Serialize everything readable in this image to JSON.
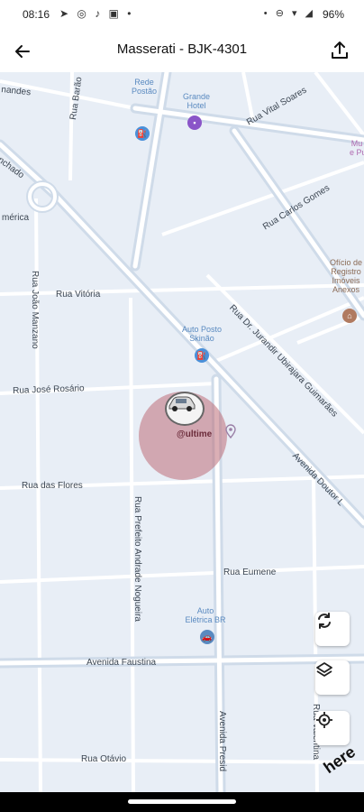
{
  "status_bar": {
    "time": "08:16",
    "left_icons": "➤ ◎ ♪ ▣ •",
    "right_icons": "• ⊖ ▾ ◢",
    "battery": "96%"
  },
  "app_bar": {
    "title": "Masserati - BJK-4301",
    "back_icon": "arrow-left-icon",
    "share_icon": "share-upload-icon"
  },
  "map": {
    "streets": [
      "nandes",
      "Rua Barão",
      "Rua Vital Soares",
      "Rua Carlos Gomes",
      "nchado",
      "mérica",
      "Rua João Manzano",
      "Rua Vitória",
      "Rua Dr. Jurandir Ubirajara Guimarães",
      "Rua José Rosário",
      "Avenida Doutor L",
      "Rua das Flores",
      "Rua Prefeito Andrade Nogueira",
      "Rua Eumene",
      "Avenida Faustina",
      "Avenida Presid",
      "Rua Otávio",
      "Rua Valentina"
    ],
    "pois": [
      {
        "name": "Rede\nPostão",
        "icon": "fuel-icon",
        "color": "#4a90d9"
      },
      {
        "name": "Grande\nHotel",
        "icon": "hotel-icon",
        "color": "#8a55c8"
      },
      {
        "name": "Auto Posto\nSkinão",
        "icon": "fuel-icon",
        "color": "#4a90d9"
      },
      {
        "name": "Auto\nElétrica BR",
        "icon": "car-service-icon",
        "color": "#5a8ac0"
      },
      {
        "name": "Ofício de\nRegistro\nImóveis\nAnexos",
        "icon": "landmark-icon",
        "color": "#b07a60"
      },
      {
        "name": "Mu\ne Pu",
        "icon": "museum-icon",
        "color": "#b06ab0"
      }
    ],
    "vehicle_label": "@ultime",
    "attribution": "here"
  },
  "controls": {
    "refresh_icon": "refresh-icon",
    "layers_icon": "layers-icon",
    "locate_icon": "locate-icon"
  }
}
